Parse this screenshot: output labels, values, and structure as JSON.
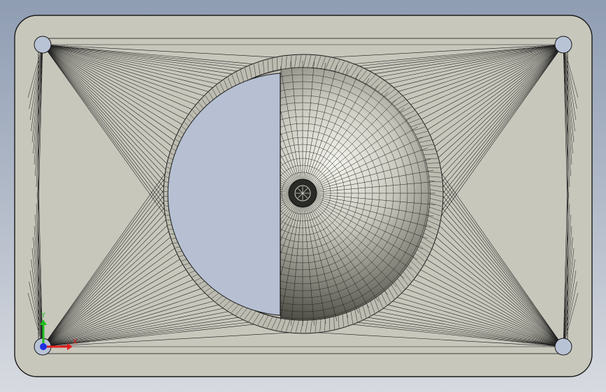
{
  "viewport": {
    "background_top": "#8f9db3",
    "background_bottom": "#d7dae0"
  },
  "part": {
    "face_color": "#c8c7bc",
    "edge_color": "#1a1a1a",
    "hole_fill": "#b9c3d6",
    "cavity_cut_fill": "#b6c0d2",
    "mesh_shading_dark": "#2e2e2a",
    "mesh_shading_light": "#f4f4ee"
  },
  "triad": {
    "x_label": "X",
    "y_label": "Y",
    "x_color": "#e02020",
    "y_color": "#20c020",
    "z_color": "#2030e0"
  }
}
